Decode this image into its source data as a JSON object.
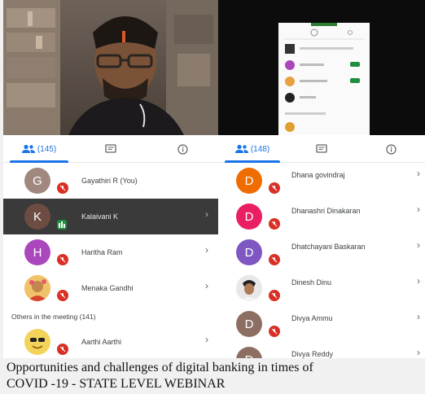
{
  "left_panel": {
    "tabs": [
      {
        "icon": "people-icon",
        "count": "(145)",
        "active": true
      },
      {
        "icon": "chat-icon",
        "active": false
      },
      {
        "icon": "info-icon",
        "active": false
      }
    ],
    "participants": [
      {
        "initial": "G",
        "name": "Gayathiri R (You)",
        "color": "#a1887f",
        "mic": "muted",
        "chevron": false
      },
      {
        "initial": "K",
        "name": "Kalaivani K",
        "color": "#6d4c41",
        "mic": "speaking",
        "chevron": true,
        "highlight": true
      },
      {
        "initial": "H",
        "name": "Haritha Ram",
        "color": "#ab47bc",
        "mic": "muted",
        "chevron": true
      },
      {
        "initial": "",
        "name": "Menaka Gandhi",
        "color": "#f0c36b",
        "mic": "muted",
        "chevron": true,
        "photo": true
      }
    ],
    "section_label": "Others in the meeting (141)",
    "others": [
      {
        "initial": "",
        "name": "Aarthi Aarthi",
        "color": "#f3d35a",
        "mic": "muted",
        "chevron": true,
        "emoji": true
      }
    ]
  },
  "right_panel": {
    "tabs": [
      {
        "icon": "people-icon",
        "count": "(148)",
        "active": true
      },
      {
        "icon": "chat-icon",
        "active": false
      },
      {
        "icon": "info-icon",
        "active": false
      }
    ],
    "participants": [
      {
        "initial": "D",
        "name": "Dhana govindraj",
        "color": "#ef6c00",
        "mic": "muted",
        "chevron": true
      },
      {
        "initial": "D",
        "name": "Dhanashri Dinakaran",
        "color": "#e91e63",
        "mic": "muted",
        "chevron": true
      },
      {
        "initial": "D",
        "name": "Dhatchayani Baskaran",
        "color": "#7e57c2",
        "mic": "muted",
        "chevron": true
      },
      {
        "initial": "",
        "name": "Dinesh Dinu",
        "color": "#dcdcdc",
        "mic": "muted",
        "chevron": true,
        "photo": true
      },
      {
        "initial": "D",
        "name": "Divya Ammu",
        "color": "#8d6e63",
        "mic": "muted",
        "chevron": true
      },
      {
        "initial": "D",
        "name": "Divya Reddy",
        "color": "#8d6e63",
        "mic": "muted",
        "chevron": true
      }
    ]
  },
  "caption": {
    "line1": "Opportunities and challenges of digital banking in times of",
    "line2": "COVID -19 - STATE LEVEL WEBINAR"
  },
  "colors": {
    "accent": "#1a73e8",
    "muted_mic": "#d93025",
    "speaking": "#1e8e3e"
  }
}
